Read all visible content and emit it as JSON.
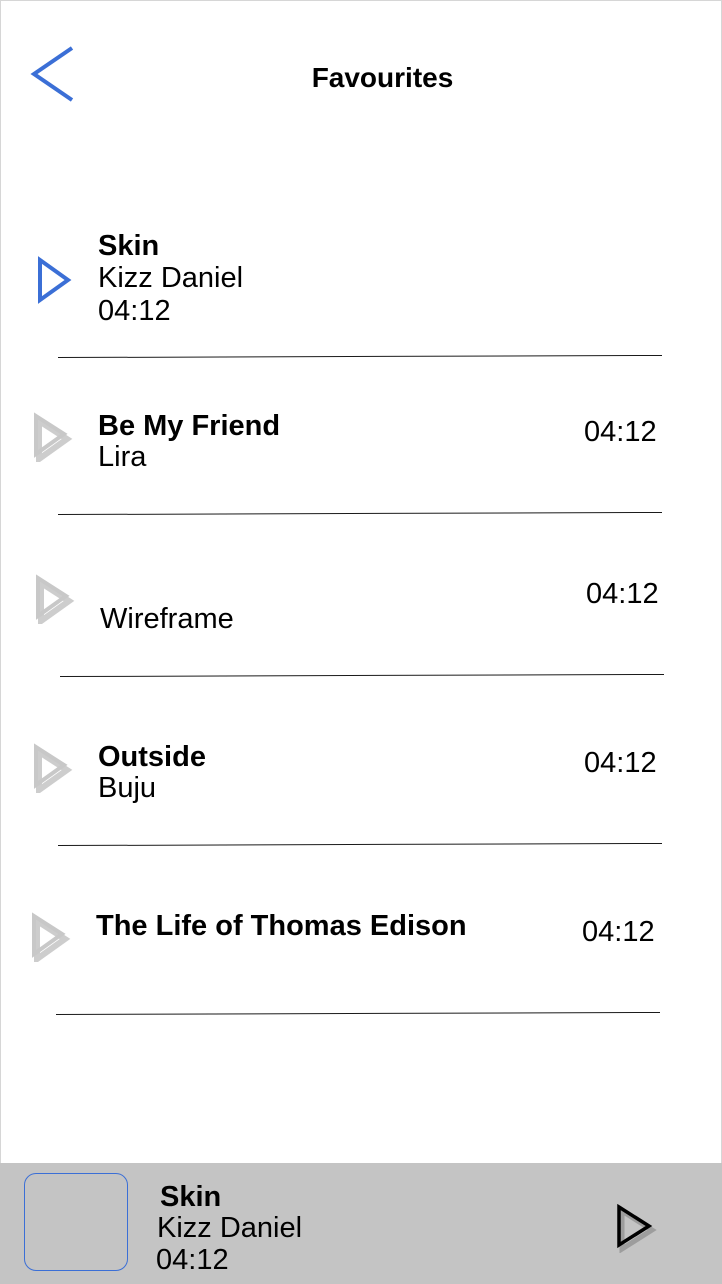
{
  "header": {
    "title": "Favourites",
    "back_icon": "chevron-left-icon"
  },
  "colors": {
    "accent": "#3b6fd6",
    "inactive_icon": "#c8c8c8",
    "player_bar": "#c4c4c4"
  },
  "songs": [
    {
      "title": "Skin",
      "artist": "Kizz Daniel",
      "duration": "04:12",
      "active": true
    },
    {
      "title": "Be My Friend",
      "artist": "Lira",
      "duration": "04:12",
      "active": false
    },
    {
      "title": "",
      "artist": "Wireframe",
      "duration": "04:12",
      "active": false
    },
    {
      "title": "Outside",
      "artist": "Buju",
      "duration": "04:12",
      "active": false
    },
    {
      "title": "The Life of Thomas Edison",
      "artist": "",
      "duration": "04:12",
      "active": false
    }
  ],
  "now_playing": {
    "title": "Skin",
    "artist": "Kizz Daniel",
    "duration": "04:12",
    "play_icon": "play-icon"
  }
}
